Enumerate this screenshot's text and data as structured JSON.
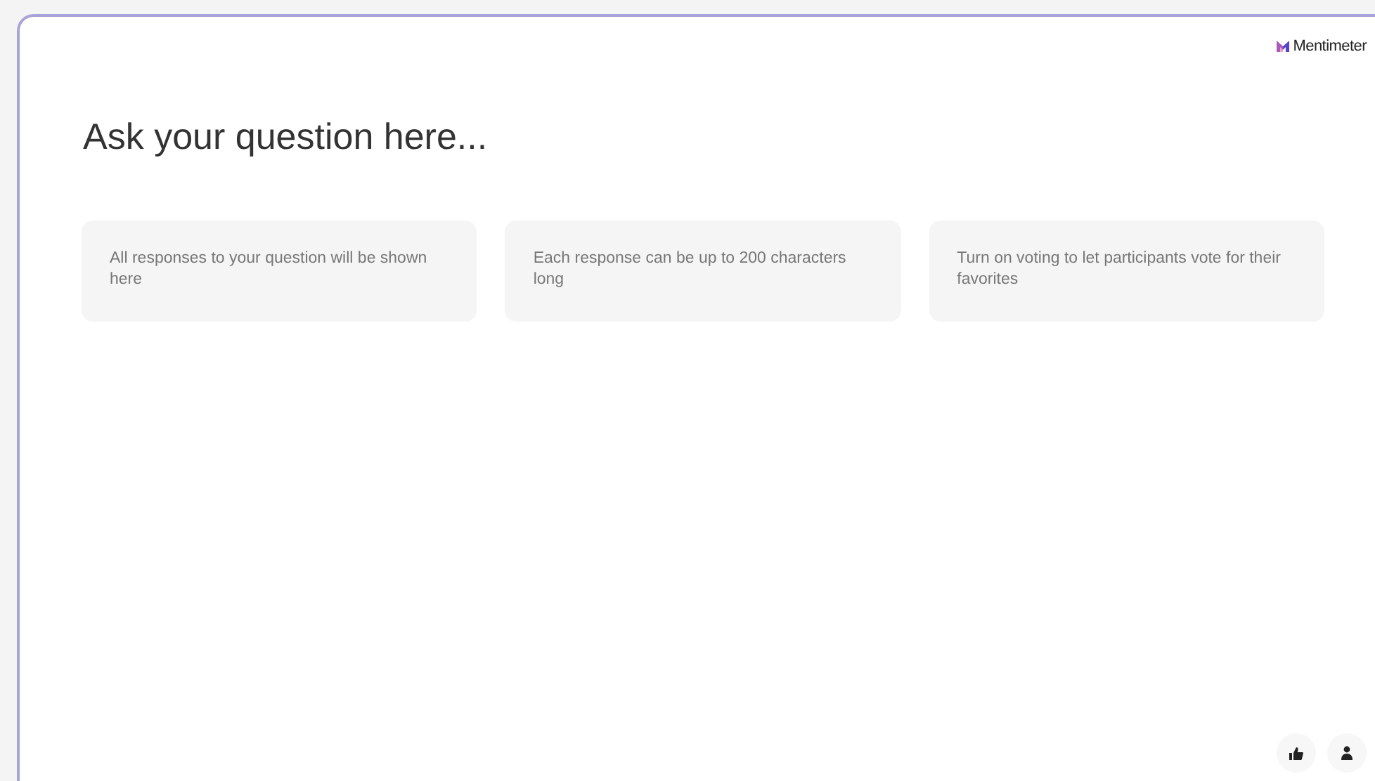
{
  "brand": {
    "name": "Mentimeter"
  },
  "question": {
    "placeholder": "Ask your question here..."
  },
  "hints": [
    {
      "text": "All responses to your question will be shown here"
    },
    {
      "text": "Each response can be up to 200 characters long"
    },
    {
      "text": "Turn on voting to let participants vote for their favorites"
    }
  ]
}
